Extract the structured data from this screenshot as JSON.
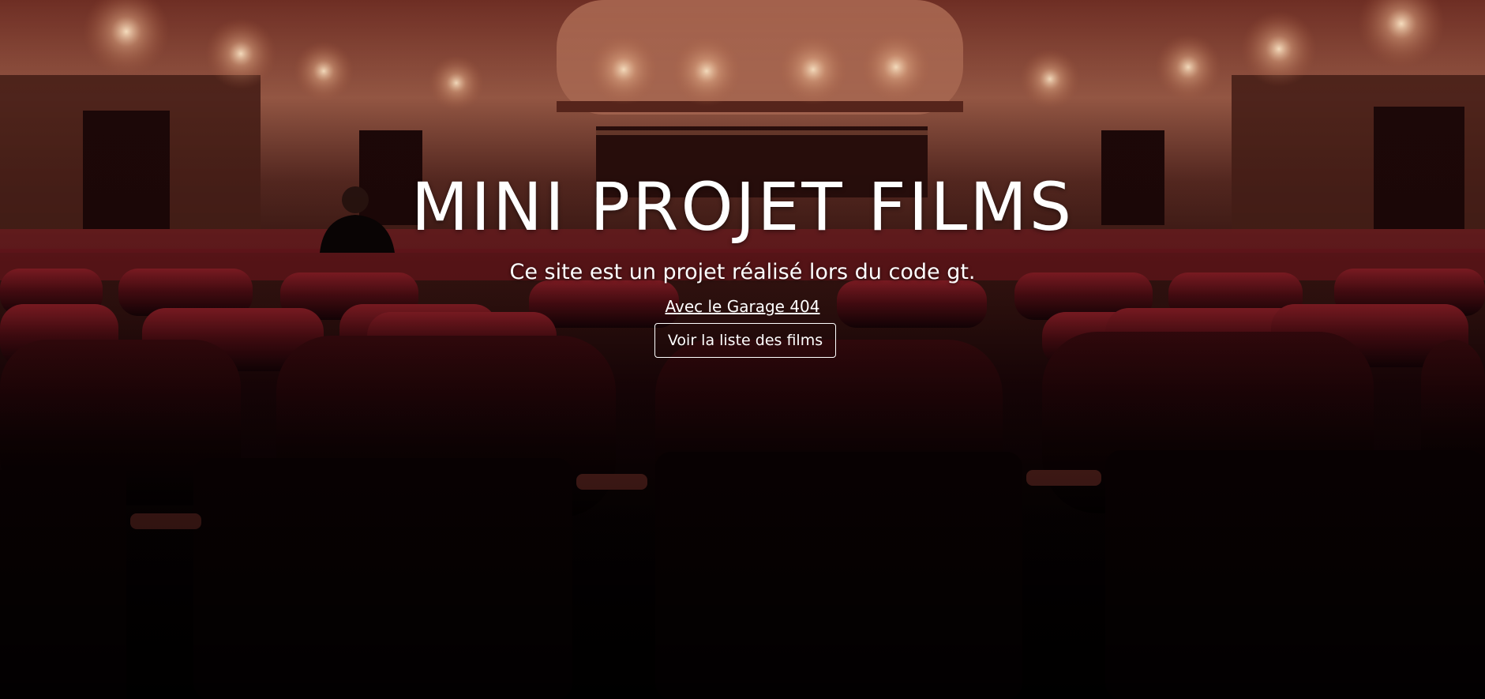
{
  "hero": {
    "title": "MINI PROJET FILMS",
    "subtitle": "Ce site est un projet réalisé lors du code gt.",
    "link_text": "Avec le Garage 404",
    "button_label": "Voir la liste des films",
    "background_image": "movie-theater-seats"
  },
  "colors": {
    "text": "#ffffff",
    "seat_red": "#7a1620",
    "wall": "#b07860",
    "dark": "#000000"
  }
}
